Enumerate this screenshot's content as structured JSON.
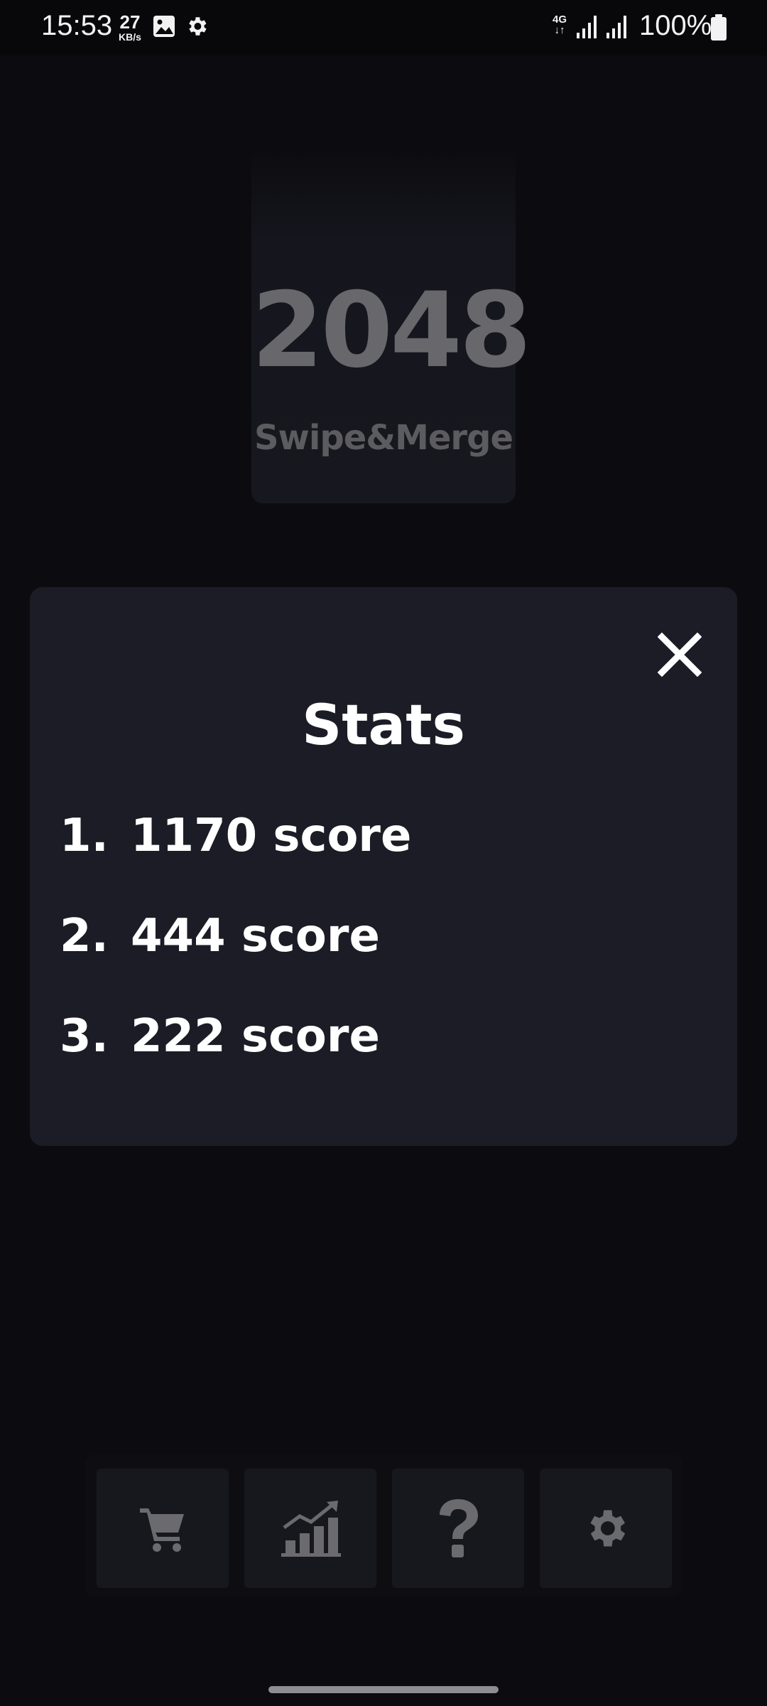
{
  "status_bar": {
    "time": "15:53",
    "net_speed_value": "27",
    "net_speed_unit": "KB/s",
    "network_type": "4G",
    "battery": "100%",
    "icons": [
      "image-icon",
      "gear-icon",
      "signal-icon",
      "signal-icon",
      "battery-icon"
    ]
  },
  "logo": {
    "title": "2048",
    "subtitle": "Swipe&Merge"
  },
  "dialog": {
    "title": "Stats",
    "close_icon": "close-icon",
    "entries": [
      {
        "rank": "1.",
        "score": "1170 score"
      },
      {
        "rank": "2.",
        "score": "444 score"
      },
      {
        "rank": "3.",
        "score": "222 score"
      }
    ]
  },
  "toolbar": {
    "buttons": [
      {
        "name": "shop",
        "icon": "cart-icon"
      },
      {
        "name": "stats",
        "icon": "chart-icon"
      },
      {
        "name": "help",
        "icon": "question-icon"
      },
      {
        "name": "settings",
        "icon": "gear-icon"
      }
    ]
  },
  "colors": {
    "background": "#0c0c10",
    "dialog": "#1c1c26",
    "toolbar_button": "#17181e",
    "icon_muted": "#6a6a6f",
    "logo_text": "#67676c"
  }
}
